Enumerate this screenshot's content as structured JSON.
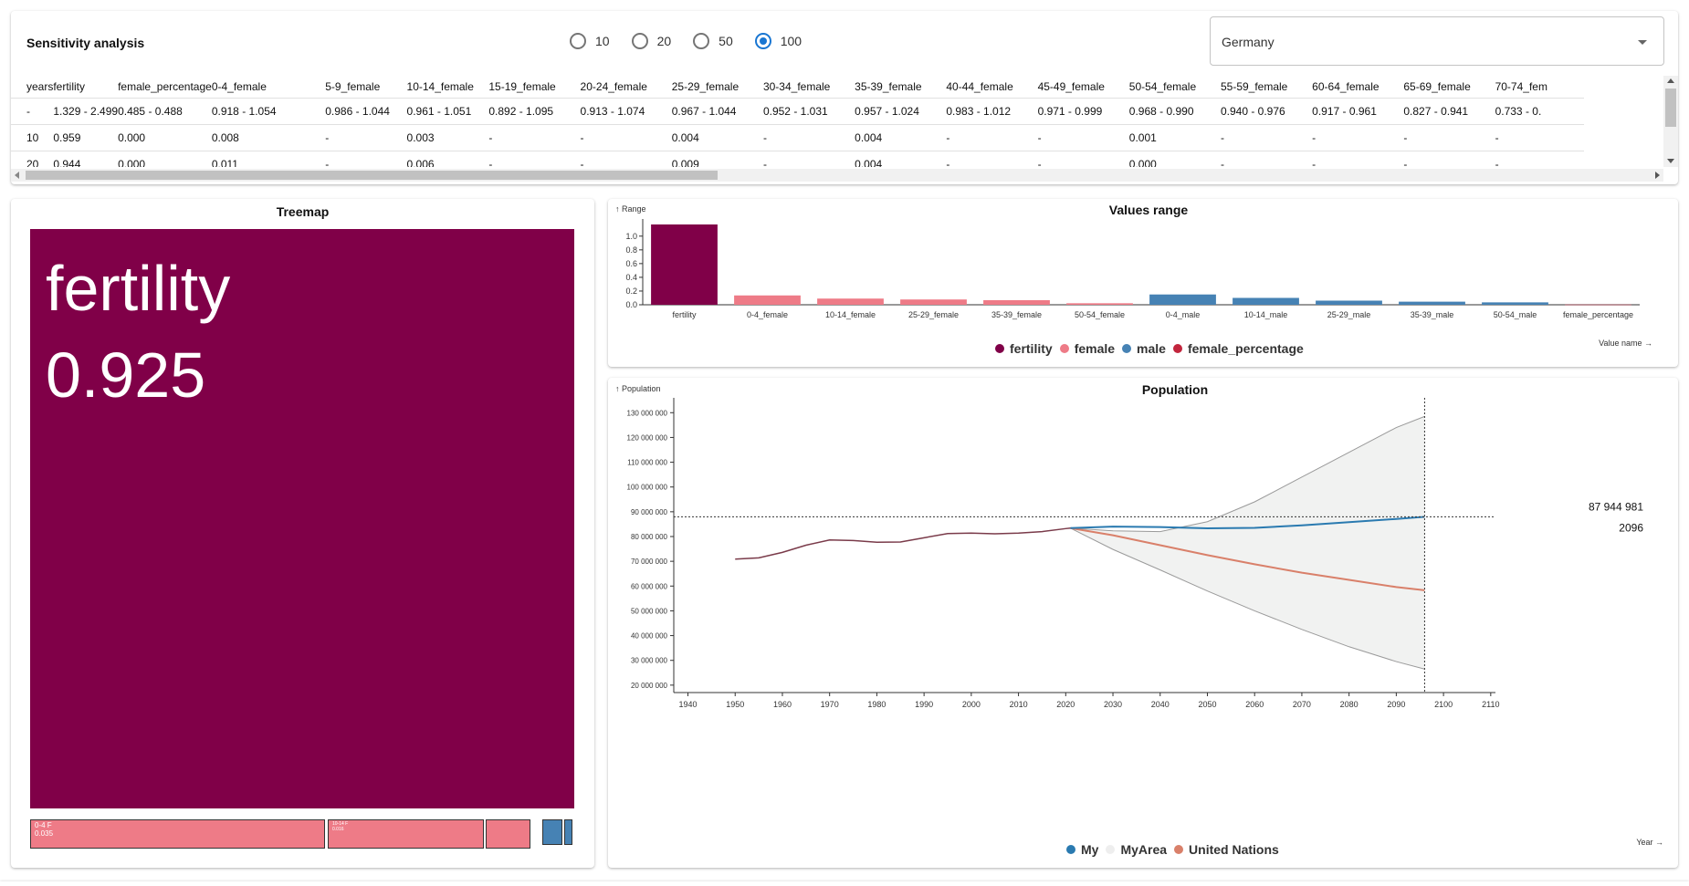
{
  "header": {
    "title": "Sensitivity analysis",
    "radio_options": [
      "10",
      "20",
      "50",
      "100"
    ],
    "radio_selected": "100",
    "country": "Germany"
  },
  "table": {
    "columns": [
      "years",
      "fertility",
      "female_percentage",
      "0-4_female",
      "5-9_female",
      "10-14_female",
      "15-19_female",
      "20-24_female",
      "25-29_female",
      "30-34_female",
      "35-39_female",
      "40-44_female",
      "45-49_female",
      "50-54_female",
      "55-59_female",
      "60-64_female",
      "65-69_female",
      "70-74_fem"
    ],
    "rows": [
      [
        "-",
        "1.329 - 2.499",
        "0.485 - 0.488",
        "0.918 - 1.054",
        "0.986 - 1.044",
        "0.961 - 1.051",
        "0.892 - 1.095",
        "0.913 - 1.074",
        "0.967 - 1.044",
        "0.952 - 1.031",
        "0.957 - 1.024",
        "0.983 - 1.012",
        "0.971 - 0.999",
        "0.968 - 0.990",
        "0.940 - 0.976",
        "0.917 - 0.961",
        "0.827 - 0.941",
        "0.733 - 0."
      ],
      [
        "10",
        "0.959",
        "0.000",
        "0.008",
        "-",
        "0.003",
        "-",
        "-",
        "0.004",
        "-",
        "0.004",
        "-",
        "-",
        "0.001",
        "-",
        "-",
        "-",
        "-"
      ],
      [
        "20",
        "0.944",
        "0.000",
        "0.011",
        "-",
        "0.006",
        "-",
        "-",
        "0.009",
        "-",
        "0.004",
        "-",
        "-",
        "0.000",
        "-",
        "-",
        "-",
        "-"
      ]
    ]
  },
  "treemap": {
    "title": "Treemap",
    "main_name": "fertility",
    "main_value": "0.925",
    "cell1_name": "0-4 F",
    "cell1_value": "0.035",
    "cell2_name": "10-14 F",
    "cell2_value": "0.016"
  },
  "colors": {
    "fertility": "#800048",
    "female": "#ee7b87",
    "male": "#4682b4",
    "female_percentage": "#c2253d",
    "my": "#2a7ab0",
    "un": "#d9806a",
    "area": "#eeeeee"
  },
  "values_chart": {
    "title": "Values range",
    "y_label": "↑ Range",
    "x_label": "Value name →",
    "y_ticks": [
      "0.0",
      "0.2",
      "0.4",
      "0.6",
      "0.8",
      "1.0"
    ],
    "chart_data": {
      "type": "bar",
      "categories": [
        "fertility",
        "0-4_female",
        "10-14_female",
        "25-29_female",
        "35-39_female",
        "50-54_female",
        "0-4_male",
        "10-14_male",
        "25-29_male",
        "35-39_male",
        "50-54_male",
        "female_percentage"
      ],
      "values": [
        1.17,
        0.136,
        0.09,
        0.077,
        0.067,
        0.022,
        0.15,
        0.1,
        0.06,
        0.045,
        0.035,
        0.003
      ],
      "groups": [
        "fertility",
        "female",
        "female",
        "female",
        "female",
        "female",
        "male",
        "male",
        "male",
        "male",
        "male",
        "female_percentage"
      ],
      "ylim": [
        0,
        1.17
      ]
    },
    "legend": [
      "fertility",
      "female",
      "male",
      "female_percentage"
    ]
  },
  "population_chart": {
    "title": "Population",
    "y_label": "↑ Population",
    "x_label": "Year →",
    "y_ticks": [
      "20 000 000",
      "30 000 000",
      "40 000 000",
      "50 000 000",
      "60 000 000",
      "70 000 000",
      "80 000 000",
      "90 000 000",
      "100 000 000",
      "110 000 000",
      "120 000 000",
      "130 000 000"
    ],
    "x_ticks": [
      "1940",
      "1950",
      "1960",
      "1970",
      "1980",
      "1990",
      "2000",
      "2010",
      "2020",
      "2030",
      "2040",
      "2050",
      "2060",
      "2070",
      "2080",
      "2090",
      "2100",
      "2110"
    ],
    "tooltip_value": "87 944 981",
    "tooltip_year": "2096",
    "legend": [
      "My",
      "MyArea",
      "United Nations"
    ],
    "chart_data": {
      "type": "line",
      "xlim": [
        1937,
        2111
      ],
      "ylim": [
        17000000,
        136000000
      ],
      "historical": {
        "x": [
          1950,
          1955,
          1960,
          1965,
          1970,
          1975,
          1980,
          1985,
          1990,
          1995,
          2000,
          2005,
          2010,
          2015,
          2020,
          2021
        ],
        "y": [
          70900000,
          71400000,
          73600000,
          76500000,
          78600000,
          78400000,
          77700000,
          77800000,
          79500000,
          81200000,
          81400000,
          81100000,
          81400000,
          82000000,
          83200000,
          83400000
        ]
      },
      "my": {
        "x": [
          2021,
          2030,
          2040,
          2050,
          2060,
          2070,
          2080,
          2090,
          2096
        ],
        "y": [
          83400000,
          84000000,
          83800000,
          83300000,
          83500000,
          84500000,
          85800000,
          87100000,
          87944981
        ]
      },
      "un": {
        "x": [
          2021,
          2030,
          2040,
          2050,
          2060,
          2070,
          2080,
          2090,
          2096
        ],
        "y": [
          83400000,
          80500000,
          76500000,
          72500000,
          68800000,
          65400000,
          62500000,
          59600000,
          58300000
        ]
      },
      "area_upper": {
        "x": [
          2021,
          2030,
          2040,
          2050,
          2060,
          2070,
          2080,
          2090,
          2096
        ],
        "y": [
          83400000,
          82300000,
          82000000,
          86000000,
          94000000,
          104000000,
          114000000,
          124000000,
          128500000
        ]
      },
      "area_lower": {
        "x": [
          2021,
          2030,
          2040,
          2050,
          2060,
          2070,
          2080,
          2090,
          2096
        ],
        "y": [
          83400000,
          74800000,
          66500000,
          58000000,
          50000000,
          42500000,
          35500000,
          29500000,
          26500000
        ]
      },
      "marker_year": 2096,
      "marker_value": 87944981
    }
  }
}
